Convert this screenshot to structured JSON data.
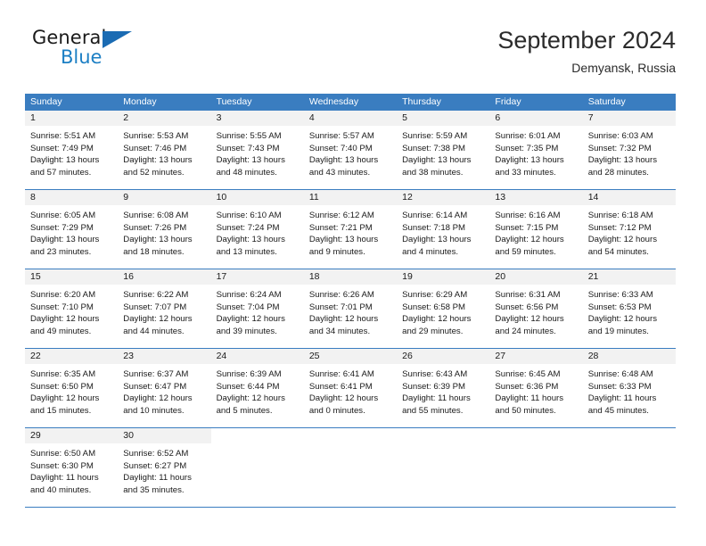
{
  "brand": {
    "name_top": "General",
    "name_bottom": "Blue",
    "triangle_color": "#1a6bb3",
    "blue_color": "#1c7fc4"
  },
  "header": {
    "title": "September 2024",
    "subtitle": "Demyansk, Russia"
  },
  "theme": {
    "header_row_bg": "#3a7dc0",
    "daynum_bg": "#f2f2f2",
    "rule_color": "#3a7dc0",
    "text_color": "#1a1a1a"
  },
  "weekdays": [
    "Sunday",
    "Monday",
    "Tuesday",
    "Wednesday",
    "Thursday",
    "Friday",
    "Saturday"
  ],
  "weeks": [
    [
      {
        "day": "1",
        "sunrise": "Sunrise: 5:51 AM",
        "sunset": "Sunset: 7:49 PM",
        "daylight1": "Daylight: 13 hours",
        "daylight2": "and 57 minutes."
      },
      {
        "day": "2",
        "sunrise": "Sunrise: 5:53 AM",
        "sunset": "Sunset: 7:46 PM",
        "daylight1": "Daylight: 13 hours",
        "daylight2": "and 52 minutes."
      },
      {
        "day": "3",
        "sunrise": "Sunrise: 5:55 AM",
        "sunset": "Sunset: 7:43 PM",
        "daylight1": "Daylight: 13 hours",
        "daylight2": "and 48 minutes."
      },
      {
        "day": "4",
        "sunrise": "Sunrise: 5:57 AM",
        "sunset": "Sunset: 7:40 PM",
        "daylight1": "Daylight: 13 hours",
        "daylight2": "and 43 minutes."
      },
      {
        "day": "5",
        "sunrise": "Sunrise: 5:59 AM",
        "sunset": "Sunset: 7:38 PM",
        "daylight1": "Daylight: 13 hours",
        "daylight2": "and 38 minutes."
      },
      {
        "day": "6",
        "sunrise": "Sunrise: 6:01 AM",
        "sunset": "Sunset: 7:35 PM",
        "daylight1": "Daylight: 13 hours",
        "daylight2": "and 33 minutes."
      },
      {
        "day": "7",
        "sunrise": "Sunrise: 6:03 AM",
        "sunset": "Sunset: 7:32 PM",
        "daylight1": "Daylight: 13 hours",
        "daylight2": "and 28 minutes."
      }
    ],
    [
      {
        "day": "8",
        "sunrise": "Sunrise: 6:05 AM",
        "sunset": "Sunset: 7:29 PM",
        "daylight1": "Daylight: 13 hours",
        "daylight2": "and 23 minutes."
      },
      {
        "day": "9",
        "sunrise": "Sunrise: 6:08 AM",
        "sunset": "Sunset: 7:26 PM",
        "daylight1": "Daylight: 13 hours",
        "daylight2": "and 18 minutes."
      },
      {
        "day": "10",
        "sunrise": "Sunrise: 6:10 AM",
        "sunset": "Sunset: 7:24 PM",
        "daylight1": "Daylight: 13 hours",
        "daylight2": "and 13 minutes."
      },
      {
        "day": "11",
        "sunrise": "Sunrise: 6:12 AM",
        "sunset": "Sunset: 7:21 PM",
        "daylight1": "Daylight: 13 hours",
        "daylight2": "and 9 minutes."
      },
      {
        "day": "12",
        "sunrise": "Sunrise: 6:14 AM",
        "sunset": "Sunset: 7:18 PM",
        "daylight1": "Daylight: 13 hours",
        "daylight2": "and 4 minutes."
      },
      {
        "day": "13",
        "sunrise": "Sunrise: 6:16 AM",
        "sunset": "Sunset: 7:15 PM",
        "daylight1": "Daylight: 12 hours",
        "daylight2": "and 59 minutes."
      },
      {
        "day": "14",
        "sunrise": "Sunrise: 6:18 AM",
        "sunset": "Sunset: 7:12 PM",
        "daylight1": "Daylight: 12 hours",
        "daylight2": "and 54 minutes."
      }
    ],
    [
      {
        "day": "15",
        "sunrise": "Sunrise: 6:20 AM",
        "sunset": "Sunset: 7:10 PM",
        "daylight1": "Daylight: 12 hours",
        "daylight2": "and 49 minutes."
      },
      {
        "day": "16",
        "sunrise": "Sunrise: 6:22 AM",
        "sunset": "Sunset: 7:07 PM",
        "daylight1": "Daylight: 12 hours",
        "daylight2": "and 44 minutes."
      },
      {
        "day": "17",
        "sunrise": "Sunrise: 6:24 AM",
        "sunset": "Sunset: 7:04 PM",
        "daylight1": "Daylight: 12 hours",
        "daylight2": "and 39 minutes."
      },
      {
        "day": "18",
        "sunrise": "Sunrise: 6:26 AM",
        "sunset": "Sunset: 7:01 PM",
        "daylight1": "Daylight: 12 hours",
        "daylight2": "and 34 minutes."
      },
      {
        "day": "19",
        "sunrise": "Sunrise: 6:29 AM",
        "sunset": "Sunset: 6:58 PM",
        "daylight1": "Daylight: 12 hours",
        "daylight2": "and 29 minutes."
      },
      {
        "day": "20",
        "sunrise": "Sunrise: 6:31 AM",
        "sunset": "Sunset: 6:56 PM",
        "daylight1": "Daylight: 12 hours",
        "daylight2": "and 24 minutes."
      },
      {
        "day": "21",
        "sunrise": "Sunrise: 6:33 AM",
        "sunset": "Sunset: 6:53 PM",
        "daylight1": "Daylight: 12 hours",
        "daylight2": "and 19 minutes."
      }
    ],
    [
      {
        "day": "22",
        "sunrise": "Sunrise: 6:35 AM",
        "sunset": "Sunset: 6:50 PM",
        "daylight1": "Daylight: 12 hours",
        "daylight2": "and 15 minutes."
      },
      {
        "day": "23",
        "sunrise": "Sunrise: 6:37 AM",
        "sunset": "Sunset: 6:47 PM",
        "daylight1": "Daylight: 12 hours",
        "daylight2": "and 10 minutes."
      },
      {
        "day": "24",
        "sunrise": "Sunrise: 6:39 AM",
        "sunset": "Sunset: 6:44 PM",
        "daylight1": "Daylight: 12 hours",
        "daylight2": "and 5 minutes."
      },
      {
        "day": "25",
        "sunrise": "Sunrise: 6:41 AM",
        "sunset": "Sunset: 6:41 PM",
        "daylight1": "Daylight: 12 hours",
        "daylight2": "and 0 minutes."
      },
      {
        "day": "26",
        "sunrise": "Sunrise: 6:43 AM",
        "sunset": "Sunset: 6:39 PM",
        "daylight1": "Daylight: 11 hours",
        "daylight2": "and 55 minutes."
      },
      {
        "day": "27",
        "sunrise": "Sunrise: 6:45 AM",
        "sunset": "Sunset: 6:36 PM",
        "daylight1": "Daylight: 11 hours",
        "daylight2": "and 50 minutes."
      },
      {
        "day": "28",
        "sunrise": "Sunrise: 6:48 AM",
        "sunset": "Sunset: 6:33 PM",
        "daylight1": "Daylight: 11 hours",
        "daylight2": "and 45 minutes."
      }
    ],
    [
      {
        "day": "29",
        "sunrise": "Sunrise: 6:50 AM",
        "sunset": "Sunset: 6:30 PM",
        "daylight1": "Daylight: 11 hours",
        "daylight2": "and 40 minutes."
      },
      {
        "day": "30",
        "sunrise": "Sunrise: 6:52 AM",
        "sunset": "Sunset: 6:27 PM",
        "daylight1": "Daylight: 11 hours",
        "daylight2": "and 35 minutes."
      },
      {
        "day": "",
        "sunrise": "",
        "sunset": "",
        "daylight1": "",
        "daylight2": ""
      },
      {
        "day": "",
        "sunrise": "",
        "sunset": "",
        "daylight1": "",
        "daylight2": ""
      },
      {
        "day": "",
        "sunrise": "",
        "sunset": "",
        "daylight1": "",
        "daylight2": ""
      },
      {
        "day": "",
        "sunrise": "",
        "sunset": "",
        "daylight1": "",
        "daylight2": ""
      },
      {
        "day": "",
        "sunrise": "",
        "sunset": "",
        "daylight1": "",
        "daylight2": ""
      }
    ]
  ]
}
